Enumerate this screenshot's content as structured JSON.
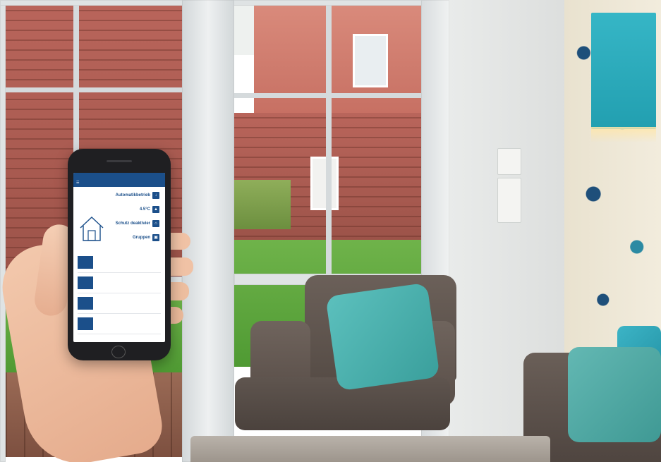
{
  "phone_app": {
    "status_bar": {
      "carrier": "",
      "time": "",
      "battery": ""
    },
    "nav": {
      "title": ""
    },
    "actions": [
      {
        "label": "Automatikbetrieb",
        "icon": "auto-icon"
      },
      {
        "label": "4.5°C",
        "icon": "thermo-icon"
      },
      {
        "label": "Schutz deaktivier",
        "icon": "shield-icon"
      },
      {
        "label": "Gruppen",
        "icon": "group-icon"
      }
    ],
    "devices": [
      {
        "tile": "",
        "text": ""
      },
      {
        "tile": "",
        "text": ""
      },
      {
        "tile": "",
        "text": ""
      },
      {
        "tile": "",
        "text": ""
      }
    ]
  },
  "colors": {
    "app_blue": "#1b4f8a",
    "lamp": "#2aa8b8",
    "cushion": "#4bb0ad"
  }
}
